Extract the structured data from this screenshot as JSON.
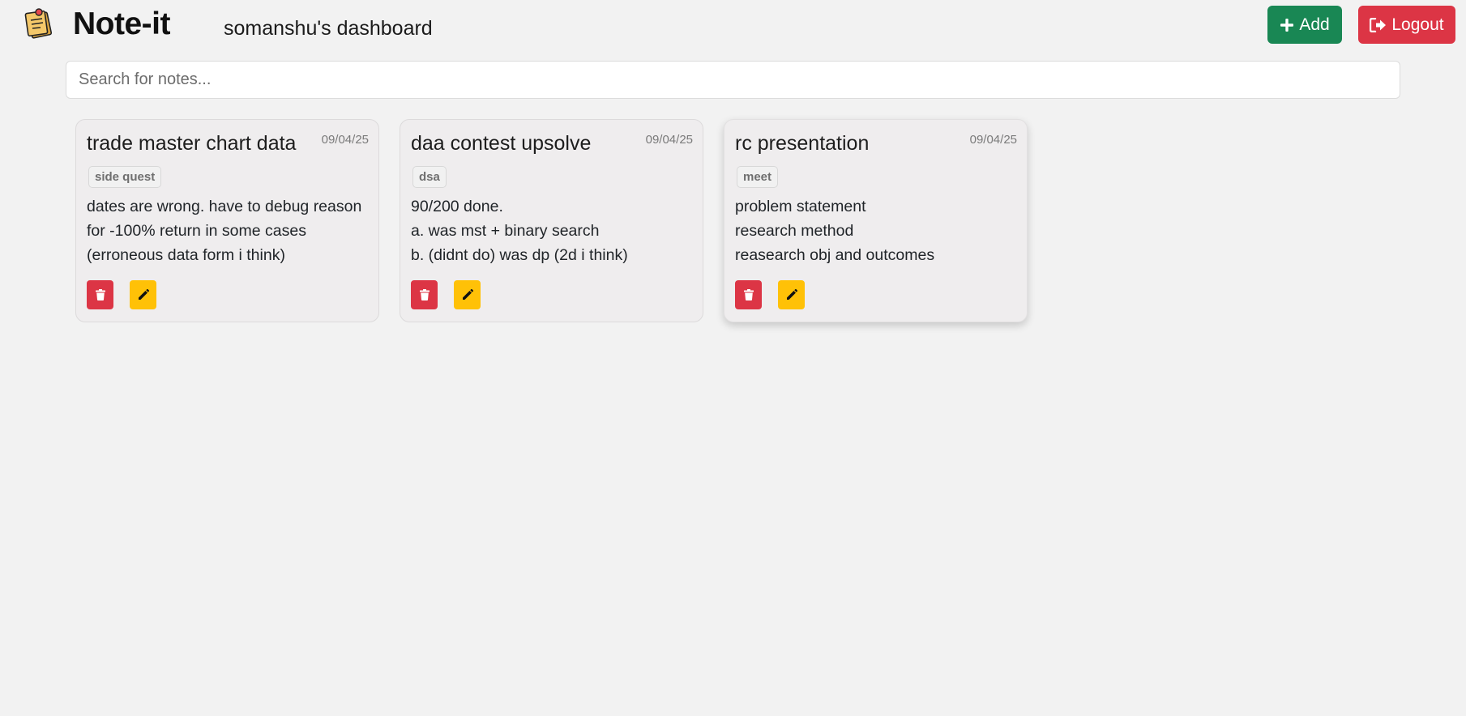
{
  "header": {
    "logo_icon": "sticky-note-pin-icon",
    "app_title": "Note-it",
    "dashboard_title": "somanshu's dashboard",
    "add_label": "Add",
    "logout_label": "Logout"
  },
  "search": {
    "placeholder": "Search for notes...",
    "value": ""
  },
  "colors": {
    "add": "#198754",
    "logout": "#dc3545",
    "delete": "#dc3545",
    "edit": "#ffc107"
  },
  "notes": [
    {
      "title": "trade master chart data",
      "date": "09/04/25",
      "tag": "side quest",
      "lines": [
        "dates are wrong. have to debug reason",
        "for -100% return in some cases",
        "(erroneous data form i think)"
      ]
    },
    {
      "title": "daa contest upsolve",
      "date": "09/04/25",
      "tag": "dsa",
      "lines": [
        "90/200 done.",
        "a. was mst + binary search",
        "b. (didnt do) was dp (2d i think)"
      ]
    },
    {
      "title": "rc presentation",
      "date": "09/04/25",
      "tag": "meet",
      "lines": [
        "problem statement",
        "research method",
        "reasearch obj and outcomes"
      ]
    }
  ]
}
